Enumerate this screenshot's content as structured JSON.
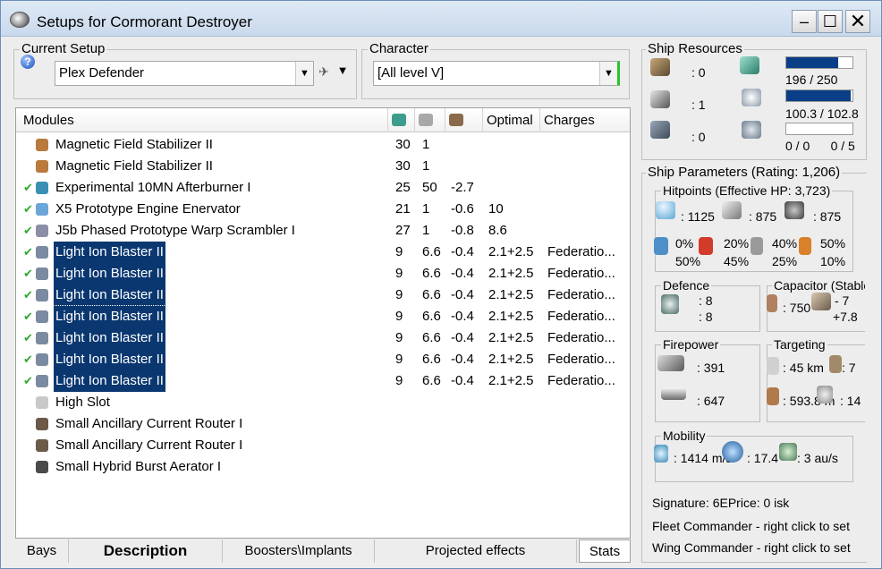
{
  "window": {
    "title": "Setups for Cormorant Destroyer"
  },
  "setup": {
    "label": "Current Setup",
    "value": "Plex Defender"
  },
  "character": {
    "label": "Character",
    "value": "[All level V]"
  },
  "modules": {
    "headers": {
      "modules": "Modules",
      "optimal": "Optimal",
      "charges": "Charges"
    },
    "rows": [
      {
        "name": "Magnetic Field Stabilizer II",
        "c1": "30",
        "c2": "1",
        "c3": "",
        "opt": "",
        "chg": "",
        "checked": false,
        "selected": false,
        "icon_color": "#b97a3c"
      },
      {
        "name": "Magnetic Field Stabilizer II",
        "c1": "30",
        "c2": "1",
        "c3": "",
        "opt": "",
        "chg": "",
        "checked": false,
        "selected": false,
        "icon_color": "#b97a3c"
      },
      {
        "name": "Experimental 10MN Afterburner I",
        "c1": "25",
        "c2": "50",
        "c3": "-2.7",
        "opt": "",
        "chg": "",
        "checked": true,
        "selected": false,
        "icon_color": "#3a8fb5"
      },
      {
        "name": "X5 Prototype Engine Enervator",
        "c1": "21",
        "c2": "1",
        "c3": "-0.6",
        "opt": "10",
        "chg": "",
        "checked": true,
        "selected": false,
        "icon_color": "#6aa6d8"
      },
      {
        "name": "J5b Phased Prototype Warp Scrambler I",
        "c1": "27",
        "c2": "1",
        "c3": "-0.8",
        "opt": "8.6",
        "chg": "",
        "checked": true,
        "selected": false,
        "icon_color": "#8a8fa6"
      },
      {
        "name": "Light Ion Blaster II",
        "c1": "9",
        "c2": "6.6",
        "c3": "-0.4",
        "opt": "2.1+2.5",
        "chg": "Federatio...",
        "checked": true,
        "selected": true,
        "icon_color": "#7a8aa0"
      },
      {
        "name": "Light Ion Blaster II",
        "c1": "9",
        "c2": "6.6",
        "c3": "-0.4",
        "opt": "2.1+2.5",
        "chg": "Federatio...",
        "checked": true,
        "selected": true,
        "icon_color": "#7a8aa0"
      },
      {
        "name": "Light Ion Blaster II",
        "c1": "9",
        "c2": "6.6",
        "c3": "-0.4",
        "opt": "2.1+2.5",
        "chg": "Federatio...",
        "checked": true,
        "selected": true,
        "icon_color": "#7a8aa0"
      },
      {
        "name": "Light Ion Blaster II",
        "c1": "9",
        "c2": "6.6",
        "c3": "-0.4",
        "opt": "2.1+2.5",
        "chg": "Federatio...",
        "checked": true,
        "selected": true,
        "icon_color": "#7a8aa0"
      },
      {
        "name": "Light Ion Blaster II",
        "c1": "9",
        "c2": "6.6",
        "c3": "-0.4",
        "opt": "2.1+2.5",
        "chg": "Federatio...",
        "checked": true,
        "selected": true,
        "icon_color": "#7a8aa0"
      },
      {
        "name": "Light Ion Blaster II",
        "c1": "9",
        "c2": "6.6",
        "c3": "-0.4",
        "opt": "2.1+2.5",
        "chg": "Federatio...",
        "checked": true,
        "selected": true,
        "icon_color": "#7a8aa0"
      },
      {
        "name": "Light Ion Blaster II",
        "c1": "9",
        "c2": "6.6",
        "c3": "-0.4",
        "opt": "2.1+2.5",
        "chg": "Federatio...",
        "checked": true,
        "selected": true,
        "icon_color": "#7a8aa0"
      },
      {
        "name": "High Slot",
        "c1": "",
        "c2": "",
        "c3": "",
        "opt": "",
        "chg": "",
        "checked": false,
        "selected": false,
        "icon_color": "#c9c9c9"
      },
      {
        "name": "Small Ancillary Current Router I",
        "c1": "",
        "c2": "",
        "c3": "",
        "opt": "",
        "chg": "",
        "checked": false,
        "selected": false,
        "icon_color": "#6b5a48"
      },
      {
        "name": "Small Ancillary Current Router I",
        "c1": "",
        "c2": "",
        "c3": "",
        "opt": "",
        "chg": "",
        "checked": false,
        "selected": false,
        "icon_color": "#6b5a48"
      },
      {
        "name": "Small Hybrid Burst Aerator I",
        "c1": "",
        "c2": "",
        "c3": "",
        "opt": "",
        "chg": "",
        "checked": false,
        "selected": false,
        "icon_color": "#4a4a4a"
      }
    ]
  },
  "tabs": [
    "Bays",
    "Description",
    "Boosters\\Implants",
    "Projected effects",
    "Stats"
  ],
  "resources": {
    "label": "Ship Resources",
    "turret": ": 0",
    "launcher": ": 1",
    "drone": ": 0",
    "cpu": "196 / 250",
    "cpu_fraction": 0.784,
    "power": "100.3 / 102.8",
    "power_fraction": 0.976,
    "drones": "0 / 0      0 / 5",
    "drones_fraction": 0.0
  },
  "params": {
    "label": "Ship Parameters (Rating: 1,206)",
    "hitpoints_label": "Hitpoints (Effective HP: 3,723)",
    "shield_hp": ": 1125",
    "armor_hp": ": 875",
    "hull_hp": ": 875",
    "resists": [
      {
        "top": "0%",
        "bottom": "50%"
      },
      {
        "top": "20%",
        "bottom": "45%"
      },
      {
        "top": "40%",
        "bottom": "25%"
      },
      {
        "top": "50%",
        "bottom": "10%"
      }
    ],
    "defence_label": "Defence",
    "defence_1": ": 8",
    "defence_2": ": 8",
    "capacitor_label": "Capacitor (Stable)",
    "cap_amount": ": 750",
    "cap_delta": "- 7",
    "cap_recharge": "+7.8",
    "firepower_label": "Firepower",
    "fp_1": ": 391",
    "fp_2": ": 647",
    "targeting_label": "Targeting",
    "targ_range": ": 45 km",
    "targ_count": ": 7",
    "targ_res": ": 593.8 m",
    "targ_strength": ": 14",
    "mobility_label": "Mobility",
    "speed": ": 1414 m/s",
    "agility": ": 17.4",
    "warp": ": 3 au/s",
    "signature": "Signature: 6EPrice: 0 isk",
    "fleet": "Fleet Commander - right click to set",
    "wing": "Wing Commander - right click to set"
  }
}
